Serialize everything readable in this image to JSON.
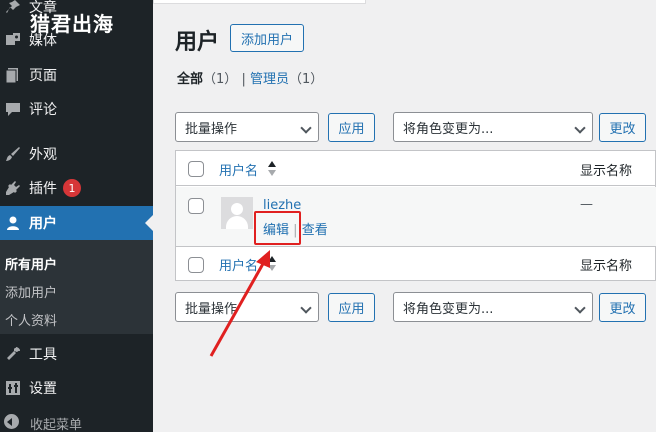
{
  "sidebar": {
    "watermark": "猎君出海",
    "items": [
      {
        "label": "文章",
        "icon": "pin-icon"
      },
      {
        "label": "媒体",
        "icon": "media-icon"
      },
      {
        "label": "页面",
        "icon": "page-icon"
      },
      {
        "label": "评论",
        "icon": "comment-icon"
      },
      {
        "label": "外观",
        "icon": "brush-icon"
      },
      {
        "label": "插件",
        "icon": "plugin-icon",
        "badge": "1"
      },
      {
        "label": "用户",
        "icon": "user-icon"
      },
      {
        "label": "工具",
        "icon": "wrench-icon"
      },
      {
        "label": "设置",
        "icon": "settings-icon"
      }
    ],
    "submenu": [
      "所有用户",
      "添加用户",
      "个人资料"
    ],
    "collapse_label": "收起菜单"
  },
  "main": {
    "page_title": "用户",
    "add_user_button": "添加用户",
    "filters": {
      "all_label": "全部",
      "all_count": "（1）",
      "sep": "|",
      "admin_label": "管理员",
      "admin_count": "（1）"
    },
    "bulk_action": "批量操作",
    "apply_button": "应用",
    "change_role": "将角色变更为...",
    "change_button": "更改",
    "table": {
      "col_username": "用户名",
      "col_display_name": "显示名称",
      "rows": [
        {
          "username": "liezhe",
          "display": "—",
          "edit": "编辑",
          "sep": "|",
          "view": "查看"
        }
      ]
    }
  },
  "annotation": {
    "color": "#e02020"
  }
}
